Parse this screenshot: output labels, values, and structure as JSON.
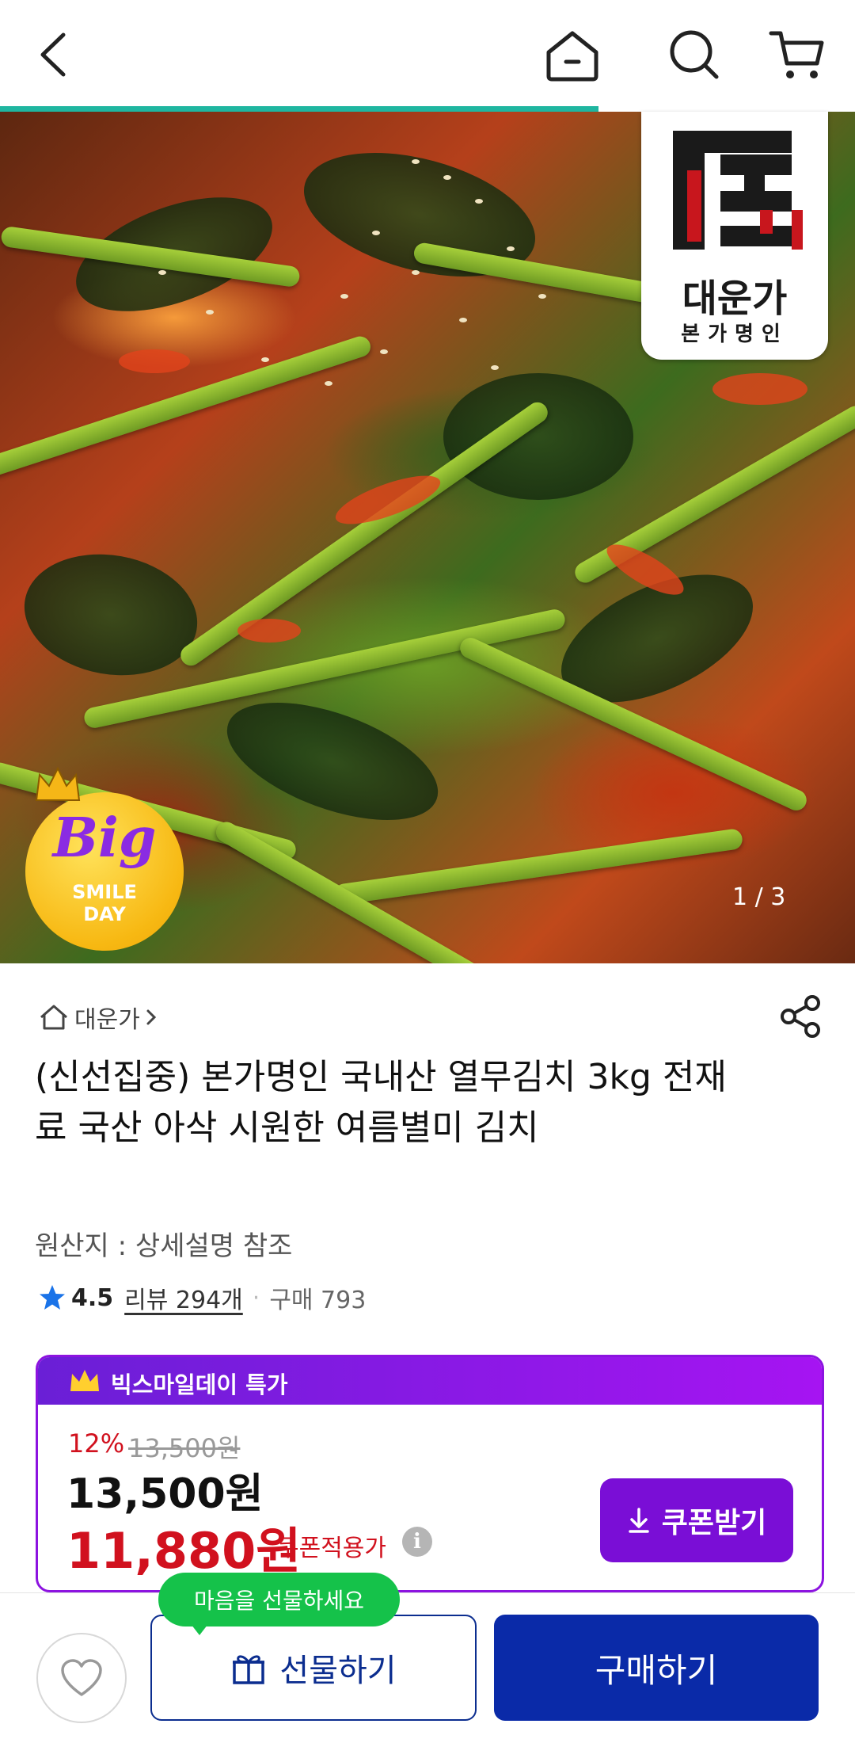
{
  "colors": {
    "accent_purple": "#8c13e0",
    "price_red": "#d1111e",
    "primary_blue": "#0a2aa8",
    "tooltip_green": "#15c24a",
    "progress_teal": "#1fb6a0"
  },
  "header": {
    "icons": [
      "back-arrow-icon",
      "home-icon",
      "search-icon",
      "cart-icon"
    ]
  },
  "image_carousel": {
    "progress_fraction": 0.7,
    "logo": {
      "title": "대운가",
      "subtitle": "본가명인"
    },
    "badge": {
      "big": "Big",
      "line1": "SMILE",
      "line2": "DAY"
    },
    "counter": "1 / 3"
  },
  "product": {
    "store_name": "대운가",
    "title": "(신선집중) 본가명인 국내산 열무김치 3kg 전재료 국산 아삭 시원한 여름별미 김치",
    "origin": "원산지 : 상세설명 참조",
    "rating": "4.5",
    "review_link": "리뷰 294개",
    "purchase_count": "구매 793"
  },
  "price_box": {
    "header_label": "빅스마일데이 특가",
    "discount_percent": "12%",
    "original_price": "13,500원",
    "current_price": "13,500원",
    "coupon_price": "11,880원",
    "coupon_label": "쿠폰적용가",
    "coupon_button": "쿠폰받기"
  },
  "bottom_bar": {
    "tooltip": "마음을 선물하세요",
    "gift_button": "선물하기",
    "buy_button": "구매하기"
  }
}
